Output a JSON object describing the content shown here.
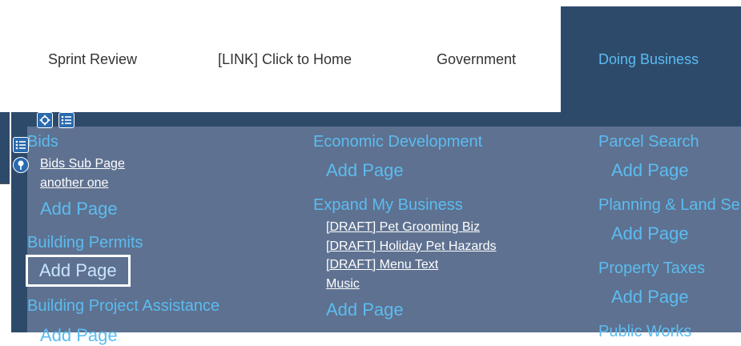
{
  "nav": {
    "items": [
      "Sprint Review",
      "[LINK] Click to Home",
      "Government"
    ],
    "active": "Doing Business"
  },
  "menu": {
    "col1": {
      "bids_title": "Bids",
      "bids_links": [
        "Bids Sub Page",
        "another one"
      ],
      "add1": "Add Page",
      "permits_title": "Building Permits",
      "add2": "Add Page",
      "assist_title": "Building Project Assistance",
      "add3": "Add Page"
    },
    "col2": {
      "econ_title": "Economic Development",
      "add1": "Add Page",
      "expand_title": "Expand My Business",
      "expand_links": [
        "[DRAFT] Pet Grooming Biz",
        "[DRAFT] Holiday Pet Hazards",
        "[DRAFT] Menu Text",
        "Music"
      ],
      "add2": "Add Page"
    },
    "col3": {
      "parcel_title": "Parcel Search",
      "add1": "Add Page",
      "planning_title": "Planning & Land Se",
      "add2": "Add Page",
      "tax_title": "Property Taxes",
      "add3": "Add Page",
      "works_title": "Public Works"
    }
  },
  "colors": {
    "accent": "#5bbcf0",
    "panel": "#5e7190",
    "dark": "#2e4a6b"
  },
  "icons": [
    "move-icon",
    "list-icon",
    "list-icon",
    "pin-icon"
  ]
}
